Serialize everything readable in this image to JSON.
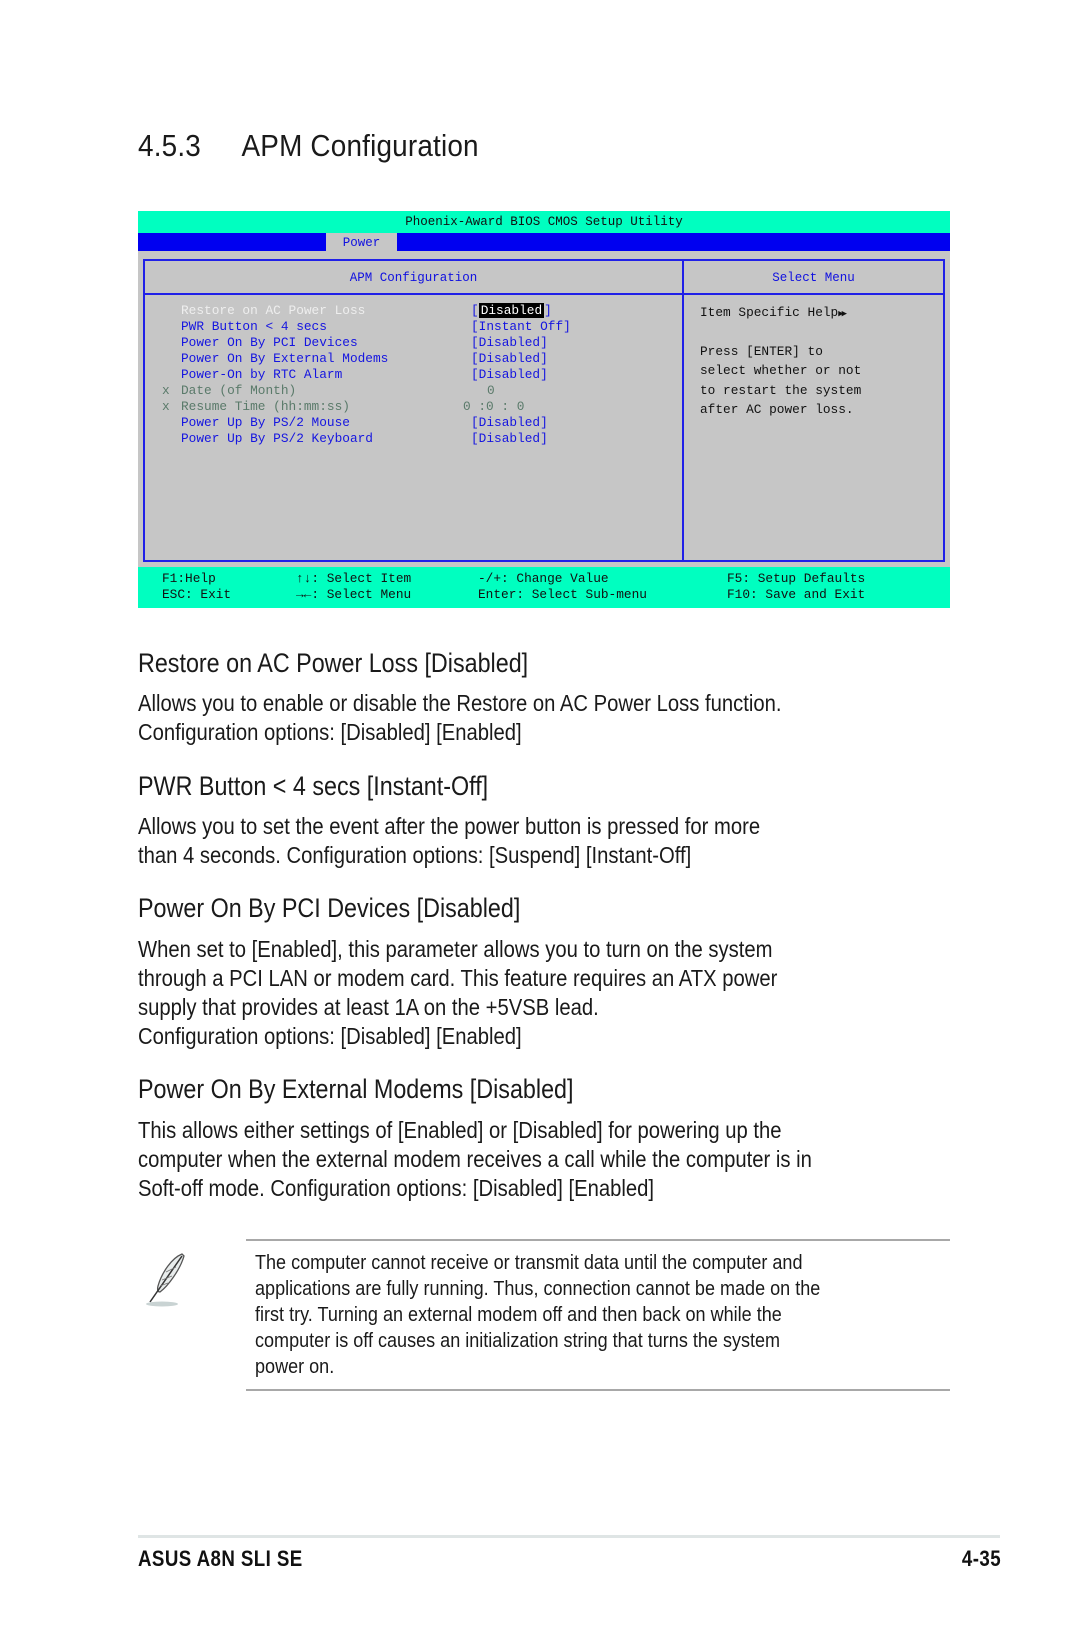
{
  "section": {
    "number": "4.5.3",
    "title": "APM Configuration"
  },
  "bios": {
    "utility_title": "Phoenix-Award BIOS CMOS Setup Utility",
    "active_tab": "Power",
    "main_panel_title": "APM Configuration",
    "help_panel_title": "Select Menu",
    "items": [
      {
        "prefix": "",
        "label": "Restore on AC Power Loss",
        "value": "Disabled",
        "state": "selected"
      },
      {
        "prefix": "",
        "label": "PWR Button < 4 secs",
        "value": "[Instant Off]",
        "state": "normal"
      },
      {
        "prefix": "",
        "label": "Power On By PCI Devices",
        "value": "[Disabled]",
        "state": "normal"
      },
      {
        "prefix": "",
        "label": "Power On By External Modems",
        "value": "[Disabled]",
        "state": "normal"
      },
      {
        "prefix": "",
        "label": "Power-On by RTC Alarm",
        "value": "[Disabled]",
        "state": "normal"
      },
      {
        "prefix": "x",
        "label": "Date (of Month)",
        "value": "0",
        "state": "disabled"
      },
      {
        "prefix": "x",
        "label": "Resume Time (hh:mm:ss)",
        "value": "0 :0 : 0",
        "state": "disabled"
      },
      {
        "prefix": "",
        "label": "Power Up By PS/2 Mouse",
        "value": "[Disabled]",
        "state": "normal"
      },
      {
        "prefix": "",
        "label": "Power Up By PS/2 Keyboard",
        "value": "[Disabled]",
        "state": "normal"
      }
    ],
    "help": {
      "heading": "Item Specific Help",
      "heading_icon": "double-right-arrow-icon",
      "lines": [
        "Press [ENTER] to",
        "select whether or not",
        "to restart the system",
        "after AC power loss."
      ]
    },
    "footer": {
      "row1": [
        "F1:Help",
        "↑↓: Select Item",
        "-/+: Change Value",
        "F5: Setup Defaults"
      ],
      "row2": [
        "ESC: Exit",
        "→←: Select Menu",
        "Enter: Select Sub-menu",
        "F10: Save and Exit"
      ]
    }
  },
  "descriptions": [
    {
      "heading": "Restore on AC Power Loss [Disabled]",
      "lines": [
        "Allows you to enable or disable the Restore on AC Power Loss function.",
        "Configuration options: [Disabled] [Enabled]"
      ]
    },
    {
      "heading": "PWR Button < 4 secs [Instant-Off]",
      "lines": [
        "Allows you to set the event after the power button is pressed for more",
        "than 4 seconds. Configuration options: [Suspend] [Instant-Off]"
      ]
    },
    {
      "heading": "Power On By PCI Devices [Disabled]",
      "lines": [
        "When set to [Enabled], this parameter allows you to turn on the system",
        "through a PCI LAN or modem card. This feature requires an ATX power",
        "supply that provides at least 1A on the +5VSB lead.",
        "Configuration options: [Disabled] [Enabled]"
      ]
    },
    {
      "heading": "Power On By External Modems [Disabled]",
      "lines": [
        "This allows either settings of [Enabled] or [Disabled] for powering up the",
        "computer when the external modem receives a call while the computer is in",
        "Soft-off mode. Configuration options: [Disabled] [Enabled]"
      ]
    }
  ],
  "note": {
    "icon": "feather-pen-icon",
    "text": "The computer cannot receive or transmit data until the computer and\napplications are fully running. Thus, connection cannot be made on the\nfirst try. Turning an external modem off and then back on while the\ncomputer is off causes an initialization string that turns the system\npower on."
  },
  "page_footer": {
    "product": "ASUS A8N SLI SE",
    "page_number": "4-35"
  }
}
